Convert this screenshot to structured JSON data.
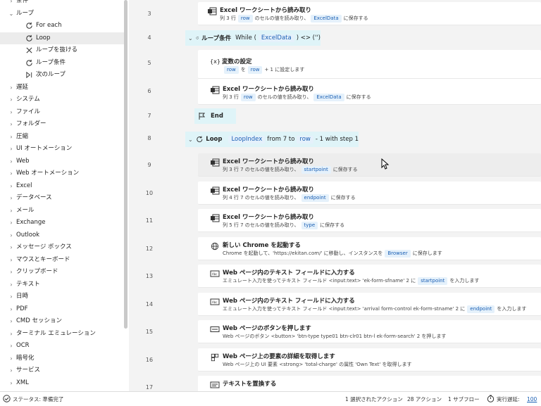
{
  "sidebar": {
    "items": [
      {
        "label": "条件",
        "kind": "group"
      },
      {
        "label": "ループ",
        "kind": "group-open"
      },
      {
        "label": "For each",
        "kind": "child",
        "icon": "loop-icon"
      },
      {
        "label": "Loop",
        "kind": "child",
        "icon": "loop-icon",
        "selected": true
      },
      {
        "label": "ループを抜ける",
        "kind": "child",
        "icon": "exit-loop-icon"
      },
      {
        "label": "ループ条件",
        "kind": "child",
        "icon": "loop-icon"
      },
      {
        "label": "次のループ",
        "kind": "child",
        "icon": "next-loop-icon"
      },
      {
        "label": "遅延",
        "kind": "group"
      },
      {
        "label": "システム",
        "kind": "group"
      },
      {
        "label": "ファイル",
        "kind": "group"
      },
      {
        "label": "フォルダー",
        "kind": "group"
      },
      {
        "label": "圧縮",
        "kind": "group"
      },
      {
        "label": "UI オートメーション",
        "kind": "group"
      },
      {
        "label": "Web",
        "kind": "group"
      },
      {
        "label": "Web オートメーション",
        "kind": "group"
      },
      {
        "label": "Excel",
        "kind": "group"
      },
      {
        "label": "データベース",
        "kind": "group"
      },
      {
        "label": "メール",
        "kind": "group"
      },
      {
        "label": "Exchange",
        "kind": "group"
      },
      {
        "label": "Outlook",
        "kind": "group"
      },
      {
        "label": "メッセージ ボックス",
        "kind": "group"
      },
      {
        "label": "マウスとキーボード",
        "kind": "group"
      },
      {
        "label": "クリップボード",
        "kind": "group"
      },
      {
        "label": "テキスト",
        "kind": "group"
      },
      {
        "label": "日時",
        "kind": "group"
      },
      {
        "label": "PDF",
        "kind": "group"
      },
      {
        "label": "CMD セッション",
        "kind": "group"
      },
      {
        "label": "ターミナル エミュレーション",
        "kind": "group"
      },
      {
        "label": "OCR",
        "kind": "group"
      },
      {
        "label": "暗号化",
        "kind": "group"
      },
      {
        "label": "サービス",
        "kind": "group"
      },
      {
        "label": "XML",
        "kind": "group"
      }
    ]
  },
  "flow": {
    "row3": {
      "num": "3",
      "title": "Excel ワークシートから読み取り",
      "d1": "列 3 行",
      "t1": "row",
      "d2": "のセルの値を読み取り、",
      "t2": "ExcelData",
      "d3": "に保存する"
    },
    "row4": {
      "num": "4",
      "kw": "ループ条件",
      "pre": "While (",
      "t1": "ExcelData",
      "mid": ") <> ('')"
    },
    "row5": {
      "num": "5",
      "title": "変数の設定",
      "t1": "row",
      "d1": "を",
      "t2": "row",
      "d2": "+ 1 に設定します"
    },
    "row6": {
      "num": "6",
      "title": "Excel ワークシートから読み取り",
      "d1": "列 3 行",
      "t1": "row",
      "d2": "のセルの値を読み取り、",
      "t2": "ExcelData",
      "d3": "に保存する"
    },
    "row7": {
      "num": "7",
      "kw": "End"
    },
    "row8": {
      "num": "8",
      "kw": "Loop",
      "t1": "LoopIndex",
      "d1": "from 7 to",
      "t2": "row",
      "d2": "- 1 with step 1"
    },
    "row9": {
      "num": "9",
      "title": "Excel ワークシートから読み取り",
      "d1": "列 3 行 7 のセルの値を読み取り、",
      "t1": "startpoint",
      "d2": "に保存する"
    },
    "row10": {
      "num": "10",
      "title": "Excel ワークシートから読み取り",
      "d1": "列 4 行 7 のセルの値を読み取り、",
      "t1": "endpoint",
      "d2": "に保存する"
    },
    "row11": {
      "num": "11",
      "title": "Excel ワークシートから読み取り",
      "d1": "列 5 行 7 のセルの値を読み取り、",
      "t1": "type",
      "d2": "に保存する"
    },
    "row12": {
      "num": "12",
      "title": "新しい Chrome を起動する",
      "d1": "Chrome を起動して、'https://ekitan.com/' に移動し、インスタンスを",
      "t1": "Browser",
      "d2": "に保存します"
    },
    "row13": {
      "num": "13",
      "title": "Web ページ内のテキスト フィールドに入力する",
      "d1": "エミュレート入力を使ってテキスト フィールド <input:text> 'ek-form-sfname' 2 に",
      "t1": "startpoint",
      "d2": "を入力します"
    },
    "row14": {
      "num": "14",
      "title": "Web ページ内のテキスト フィールドに入力する",
      "d1": "エミュレート入力を使ってテキスト フィールド <input:text> 'arrival form-control ek-form-stname' 2 に",
      "t1": "endpoint",
      "d2": "を入力します"
    },
    "row15": {
      "num": "15",
      "title": "Web ページのボタンを押します",
      "d1": "Web ページのボタン <button> 'btn-type type01 btn-clr01 btn-l ek-form-search' 2 を押します"
    },
    "row16": {
      "num": "16",
      "title": "Web ページ上の要素の詳細を取得します",
      "d1": "Web ページ上の UI 要素 <strong> 'total-charge' の属性 'Own Text' を取得します"
    },
    "row17": {
      "num": "17",
      "title": "テキストを置換する"
    }
  },
  "status": {
    "text": "ステータス: 準備完了",
    "selected": "1 選択されたアクション",
    "actions": "28 アクション",
    "subflows": "1 サブフロー",
    "delay_label": "実行遅延:",
    "delay_value": "100"
  }
}
